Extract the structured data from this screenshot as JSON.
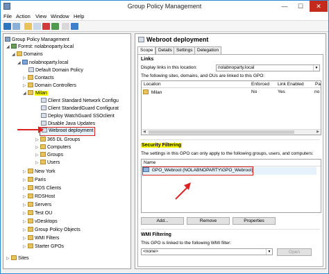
{
  "window": {
    "title": "Group Policy Management",
    "minimize": "—",
    "maximize": "☐",
    "close": "✕"
  },
  "menu": [
    "File",
    "Action",
    "View",
    "Window",
    "Help"
  ],
  "tree": {
    "root": "Group Policy Management",
    "forest": "Forest: nolabnoparty.local",
    "domains": "Domains",
    "domain": "nolabnoparty.local",
    "default_policy": "Default Domain Policy",
    "contacts": "Contacts",
    "domain_controllers": "Domain Controllers",
    "milan": "Milan",
    "milan_children": [
      "Client Standard Network Configu",
      "Client StandardGuard Configurat",
      "Deploy WatchGuard SSOclient",
      "Disable Java Updates",
      "Webroot deployment"
    ],
    "milan_ous": [
      "365 DL Groups",
      "Computers",
      "Groups",
      "Users"
    ],
    "others": [
      "New York",
      "Paris",
      "RDS Clients",
      "RDSHost",
      "Servers",
      "Test OU",
      "vDesktops",
      "Group Policy Objects",
      "WMI Filters",
      "Starter GPOs"
    ],
    "sites": "Sites"
  },
  "right": {
    "title": "Webroot deployment",
    "tabs": [
      "Scope",
      "Details",
      "Settings",
      "Delegation"
    ],
    "links": {
      "heading": "Links",
      "display_label": "Display links in this location:",
      "display_value": "nolabnoparty.local",
      "info": "The following sites, domains, and OUs are linked to this GPO:",
      "columns": [
        "Location",
        "Enforced",
        "Link Enabled",
        "Pa"
      ],
      "rows": [
        [
          "Milan",
          "No",
          "Yes",
          "no"
        ]
      ]
    },
    "security": {
      "heading": "Security Filtering",
      "info": "The settings in this GPO can only apply to the following groups, users, and computers:",
      "column": "Name",
      "rows": [
        "GPO_Webroot (NOLABNOPARTY\\GPO_Webroot)"
      ],
      "buttons": [
        "Add...",
        "Remove",
        "Properties"
      ]
    },
    "wmi": {
      "heading": "WMI Filtering",
      "info": "This GPO is linked to the following WMI filter:",
      "value": "<none>",
      "open": "Open"
    }
  },
  "colors": {
    "highlight": "#ffff00",
    "callout": "#dd2222",
    "title_border": "#2a8ad4"
  }
}
